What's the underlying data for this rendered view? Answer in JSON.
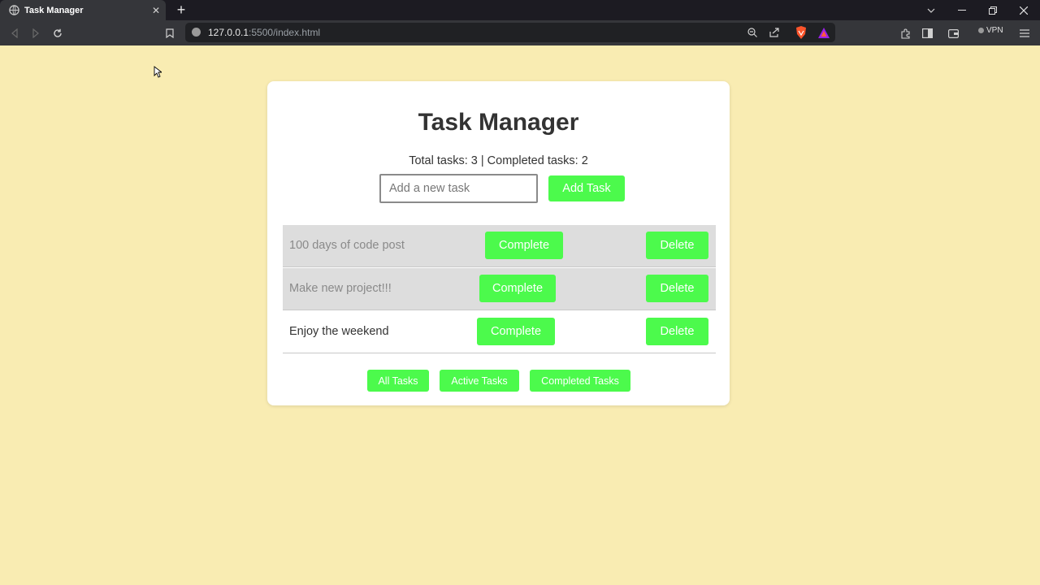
{
  "browser": {
    "tab_title": "Task Manager",
    "url_host": "127.0.0.1",
    "url_path": ":5500/index.html",
    "vpn_label": "VPN"
  },
  "app": {
    "title": "Task Manager",
    "stats": "Total tasks: 3 | Completed tasks: 2",
    "input_placeholder": "Add a new task",
    "add_button": "Add Task",
    "tasks": [
      {
        "text": "100 days of code post",
        "complete_label": "Complete",
        "delete_label": "Delete",
        "completed": true
      },
      {
        "text": "Make new project!!!",
        "complete_label": "Complete",
        "delete_label": "Delete",
        "completed": true
      },
      {
        "text": "Enjoy the weekend",
        "complete_label": "Complete",
        "delete_label": "Delete",
        "completed": false
      }
    ],
    "filters": [
      "All Tasks",
      "Active Tasks",
      "Completed Tasks"
    ],
    "colors": {
      "page_bg": "#f9ecb2",
      "accent_green": "#4cfa4c",
      "completed_row_bg": "#dddddd"
    }
  }
}
